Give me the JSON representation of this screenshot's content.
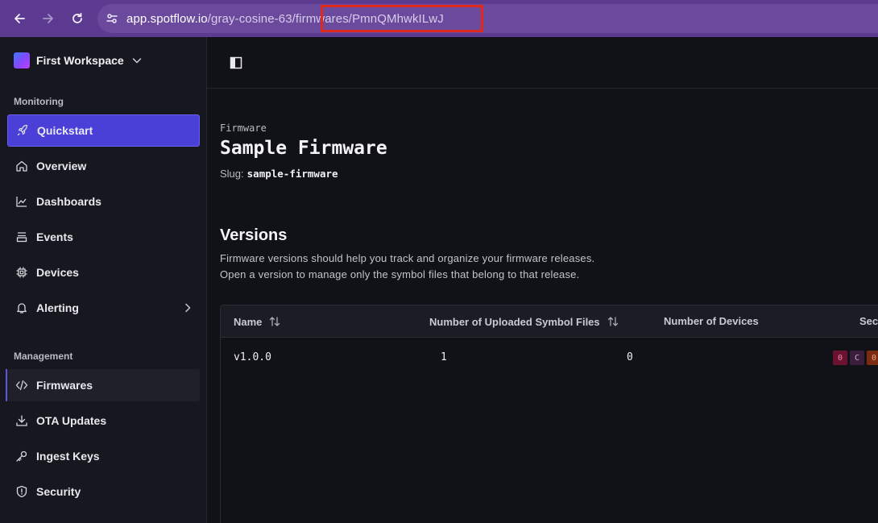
{
  "browser": {
    "url_host": "app.spotflow.io",
    "url_path": "/gray-cosine-63/firmwares/PmnQMhwkILwJ"
  },
  "sidebar": {
    "workspace_name": "First Workspace",
    "monitoring_label": "Monitoring",
    "management_label": "Management",
    "items": [
      {
        "label": "Quickstart",
        "icon": "rocket-icon"
      },
      {
        "label": "Overview",
        "icon": "home-icon"
      },
      {
        "label": "Dashboards",
        "icon": "chart-line-icon"
      },
      {
        "label": "Events",
        "icon": "list-icon"
      },
      {
        "label": "Devices",
        "icon": "chip-icon"
      },
      {
        "label": "Alerting",
        "icon": "bell-icon"
      },
      {
        "label": "Firmwares",
        "icon": "code-icon"
      },
      {
        "label": "OTA Updates",
        "icon": "download-icon"
      },
      {
        "label": "Ingest Keys",
        "icon": "key-icon"
      },
      {
        "label": "Security",
        "icon": "shield-icon"
      }
    ]
  },
  "main": {
    "eyebrow": "Firmware",
    "title": "Sample Firmware",
    "slug_label": "Slug:",
    "slug_value": "sample-firmware",
    "versions_title": "Versions",
    "desc_line1": "Firmware versions should help you track and organize your firmware releases.",
    "desc_line2": "Open a version to manage only the symbol files that belong to that release.",
    "table": {
      "columns": [
        "Name",
        "Number of Uploaded Symbol Files",
        "Number of Devices",
        "Sec"
      ],
      "rows": [
        {
          "name": "v1.0.0",
          "symbol_files": "1",
          "devices": "0",
          "badges": [
            "0",
            "C",
            "0"
          ]
        }
      ]
    }
  },
  "colors": {
    "browser_bar": "#5b3a8f",
    "active_nav": "#4a3fd6",
    "highlight_box": "#e0291d",
    "badge_critical": "#6b1230",
    "badge_high": "#3a1e3c",
    "badge_medium": "#7a2d12"
  }
}
